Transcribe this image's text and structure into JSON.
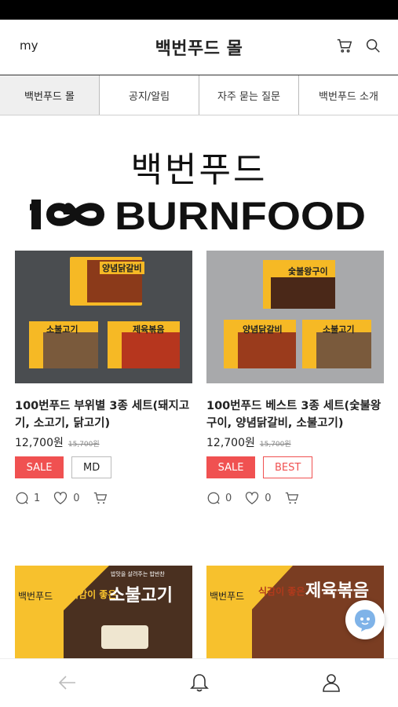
{
  "header": {
    "my_label": "my",
    "title": "백번푸드 몰",
    "icons": [
      "cart-icon",
      "search-icon"
    ]
  },
  "tabs": [
    {
      "label": "백번푸드 몰",
      "active": true
    },
    {
      "label": "공지/알림",
      "active": false
    },
    {
      "label": "자주 묻는 질문",
      "active": false
    },
    {
      "label": "백번푸드 소개",
      "active": false
    }
  ],
  "brand": {
    "korean": "백번푸드",
    "logo_text": "BURNFOOD"
  },
  "products": [
    {
      "name": "100번푸드 부위별 3종 세트(돼지고기, 소고기, 닭고기)",
      "price": "12,700원",
      "original_price": "15,700원",
      "badges": [
        "SALE",
        "MD"
      ],
      "comments": "1",
      "likes": "0",
      "image_labels": [
        "양념닭갈비",
        "소불고기",
        "제육볶음"
      ]
    },
    {
      "name": "100번푸드 베스트 3종 세트(숯불왕구이, 양념닭갈비, 소불고기)",
      "price": "12,700원",
      "original_price": "15,700원",
      "badges": [
        "SALE",
        "BEST"
      ],
      "comments": "0",
      "likes": "0",
      "image_labels": [
        "숯불왕구이",
        "양념닭갈비",
        "소불고기"
      ]
    }
  ],
  "banners": [
    {
      "brand": "백번푸드",
      "tagline": "식감이 좋은",
      "dish": "소불고기",
      "small": "밥맛을 살려주는 밥반찬"
    },
    {
      "brand": "백번푸드",
      "tagline": "식감이 좋은",
      "dish": "제육볶음",
      "small": ""
    }
  ],
  "bottom_nav": {
    "icons": [
      "back-arrow-icon",
      "bell-icon",
      "user-icon"
    ]
  },
  "colors": {
    "sale": "#f05151",
    "banner_yellow": "#f7c12d",
    "tab_active_bg": "#efefef"
  }
}
